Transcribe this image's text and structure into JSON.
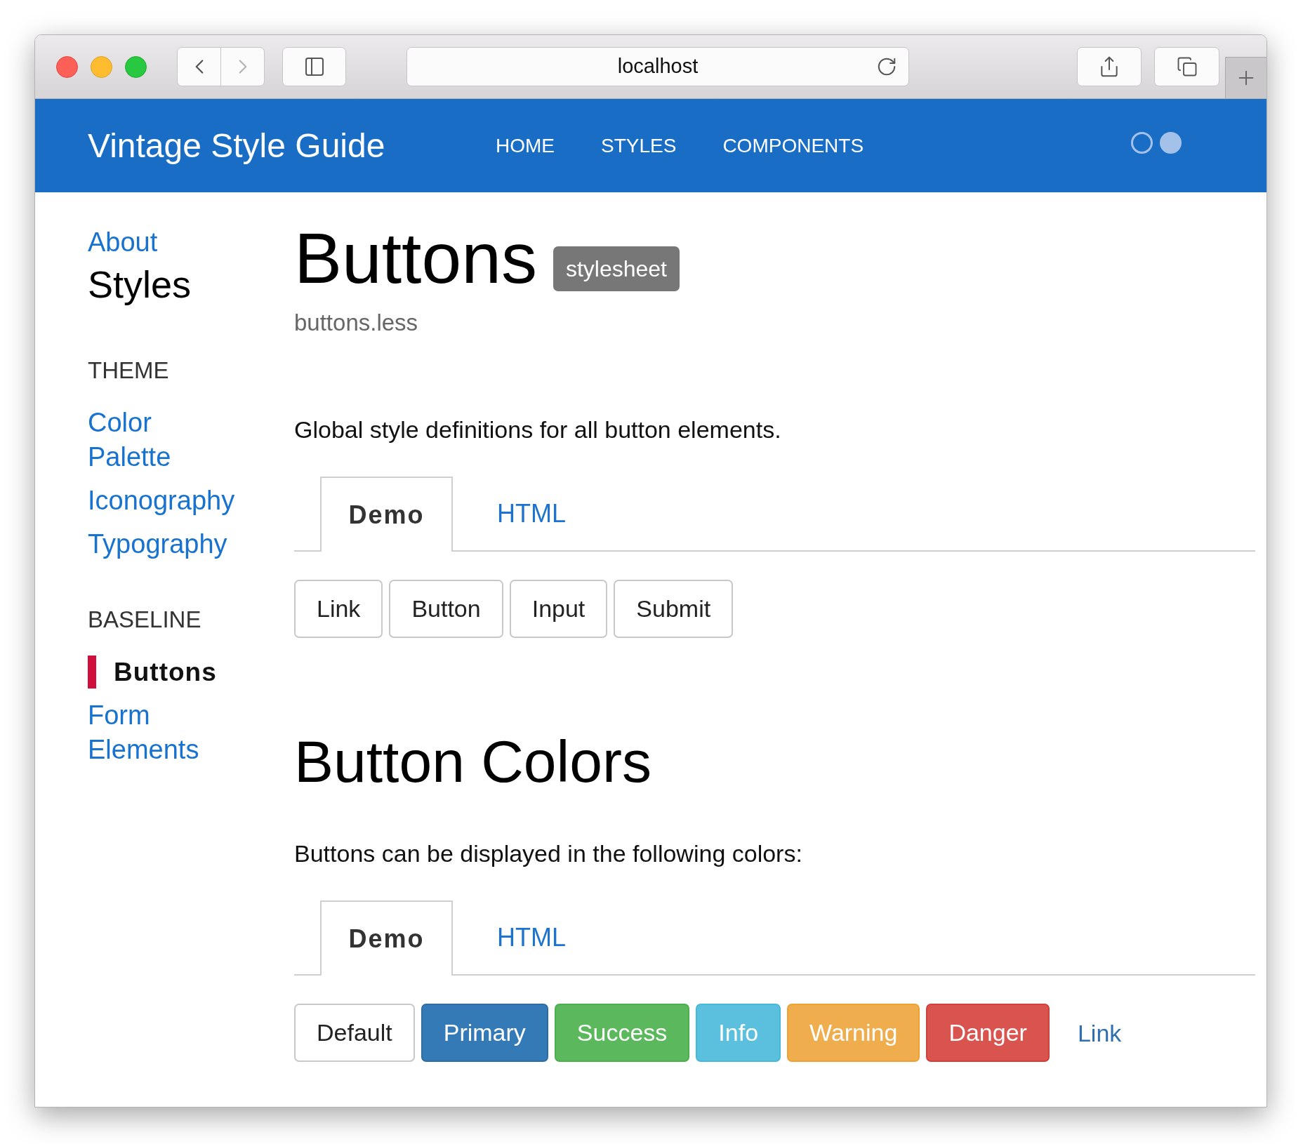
{
  "browser": {
    "nav_buttons": [
      {
        "disabled": false
      },
      {
        "disabled": true
      }
    ],
    "address": "localhost"
  },
  "header": {
    "title": "Vintage Style Guide",
    "nav": [
      {
        "label": "HOME"
      },
      {
        "label": "STYLES"
      },
      {
        "label": "COMPONENTS"
      }
    ],
    "theme_dots": [
      {
        "selected": false
      },
      {
        "selected": true
      }
    ]
  },
  "sidebar": {
    "top_link": "About",
    "title": "Styles",
    "sections": [
      {
        "heading": "THEME",
        "items": [
          {
            "label": "Color Palette",
            "selected": false
          },
          {
            "label": "Iconography",
            "selected": false
          },
          {
            "label": "Typography",
            "selected": false
          }
        ]
      },
      {
        "heading": "BASELINE",
        "items": [
          {
            "label": "Buttons",
            "selected": true
          },
          {
            "label": "Form Elements",
            "selected": false
          }
        ]
      }
    ]
  },
  "content": {
    "sections": [
      {
        "kind": "page",
        "title": "Buttons",
        "badge": "stylesheet",
        "file": "buttons.less",
        "description": "Global style definitions for all button elements.",
        "tabs": [
          {
            "label": "Demo",
            "selected": true
          },
          {
            "label": "HTML",
            "selected": false
          }
        ],
        "buttons": [
          {
            "label": "Link",
            "kind": "default"
          },
          {
            "label": "Button",
            "kind": "default"
          },
          {
            "label": "Input",
            "kind": "default"
          },
          {
            "label": "Submit",
            "kind": "default"
          }
        ]
      },
      {
        "kind": "section",
        "title": "Button Colors",
        "description": "Buttons can be displayed in the following colors:",
        "tabs": [
          {
            "label": "Demo",
            "selected": true
          },
          {
            "label": "HTML",
            "selected": false
          }
        ],
        "buttons": [
          {
            "label": "Default",
            "kind": "default"
          },
          {
            "label": "Primary",
            "kind": "primary"
          },
          {
            "label": "Success",
            "kind": "success"
          },
          {
            "label": "Info",
            "kind": "info"
          },
          {
            "label": "Warning",
            "kind": "warning"
          },
          {
            "label": "Danger",
            "kind": "danger"
          },
          {
            "label": "Link",
            "kind": "link"
          }
        ]
      }
    ]
  }
}
